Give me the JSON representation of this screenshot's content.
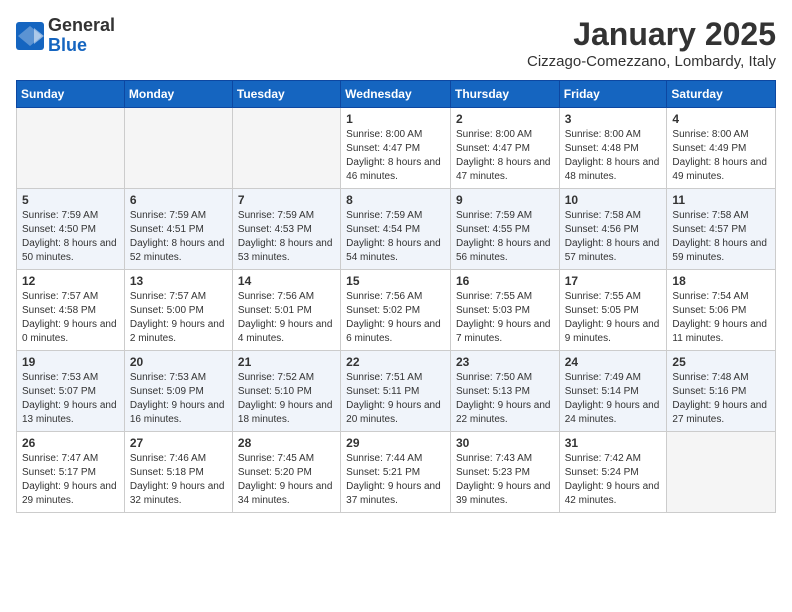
{
  "header": {
    "logo": {
      "general": "General",
      "blue": "Blue"
    },
    "title": "January 2025",
    "location": "Cizzago-Comezzano, Lombardy, Italy"
  },
  "days_of_week": [
    "Sunday",
    "Monday",
    "Tuesday",
    "Wednesday",
    "Thursday",
    "Friday",
    "Saturday"
  ],
  "weeks": [
    [
      {
        "day": "",
        "info": ""
      },
      {
        "day": "",
        "info": ""
      },
      {
        "day": "",
        "info": ""
      },
      {
        "day": "1",
        "info": "Sunrise: 8:00 AM\nSunset: 4:47 PM\nDaylight: 8 hours and 46 minutes."
      },
      {
        "day": "2",
        "info": "Sunrise: 8:00 AM\nSunset: 4:47 PM\nDaylight: 8 hours and 47 minutes."
      },
      {
        "day": "3",
        "info": "Sunrise: 8:00 AM\nSunset: 4:48 PM\nDaylight: 8 hours and 48 minutes."
      },
      {
        "day": "4",
        "info": "Sunrise: 8:00 AM\nSunset: 4:49 PM\nDaylight: 8 hours and 49 minutes."
      }
    ],
    [
      {
        "day": "5",
        "info": "Sunrise: 7:59 AM\nSunset: 4:50 PM\nDaylight: 8 hours and 50 minutes."
      },
      {
        "day": "6",
        "info": "Sunrise: 7:59 AM\nSunset: 4:51 PM\nDaylight: 8 hours and 52 minutes."
      },
      {
        "day": "7",
        "info": "Sunrise: 7:59 AM\nSunset: 4:53 PM\nDaylight: 8 hours and 53 minutes."
      },
      {
        "day": "8",
        "info": "Sunrise: 7:59 AM\nSunset: 4:54 PM\nDaylight: 8 hours and 54 minutes."
      },
      {
        "day": "9",
        "info": "Sunrise: 7:59 AM\nSunset: 4:55 PM\nDaylight: 8 hours and 56 minutes."
      },
      {
        "day": "10",
        "info": "Sunrise: 7:58 AM\nSunset: 4:56 PM\nDaylight: 8 hours and 57 minutes."
      },
      {
        "day": "11",
        "info": "Sunrise: 7:58 AM\nSunset: 4:57 PM\nDaylight: 8 hours and 59 minutes."
      }
    ],
    [
      {
        "day": "12",
        "info": "Sunrise: 7:57 AM\nSunset: 4:58 PM\nDaylight: 9 hours and 0 minutes."
      },
      {
        "day": "13",
        "info": "Sunrise: 7:57 AM\nSunset: 5:00 PM\nDaylight: 9 hours and 2 minutes."
      },
      {
        "day": "14",
        "info": "Sunrise: 7:56 AM\nSunset: 5:01 PM\nDaylight: 9 hours and 4 minutes."
      },
      {
        "day": "15",
        "info": "Sunrise: 7:56 AM\nSunset: 5:02 PM\nDaylight: 9 hours and 6 minutes."
      },
      {
        "day": "16",
        "info": "Sunrise: 7:55 AM\nSunset: 5:03 PM\nDaylight: 9 hours and 7 minutes."
      },
      {
        "day": "17",
        "info": "Sunrise: 7:55 AM\nSunset: 5:05 PM\nDaylight: 9 hours and 9 minutes."
      },
      {
        "day": "18",
        "info": "Sunrise: 7:54 AM\nSunset: 5:06 PM\nDaylight: 9 hours and 11 minutes."
      }
    ],
    [
      {
        "day": "19",
        "info": "Sunrise: 7:53 AM\nSunset: 5:07 PM\nDaylight: 9 hours and 13 minutes."
      },
      {
        "day": "20",
        "info": "Sunrise: 7:53 AM\nSunset: 5:09 PM\nDaylight: 9 hours and 16 minutes."
      },
      {
        "day": "21",
        "info": "Sunrise: 7:52 AM\nSunset: 5:10 PM\nDaylight: 9 hours and 18 minutes."
      },
      {
        "day": "22",
        "info": "Sunrise: 7:51 AM\nSunset: 5:11 PM\nDaylight: 9 hours and 20 minutes."
      },
      {
        "day": "23",
        "info": "Sunrise: 7:50 AM\nSunset: 5:13 PM\nDaylight: 9 hours and 22 minutes."
      },
      {
        "day": "24",
        "info": "Sunrise: 7:49 AM\nSunset: 5:14 PM\nDaylight: 9 hours and 24 minutes."
      },
      {
        "day": "25",
        "info": "Sunrise: 7:48 AM\nSunset: 5:16 PM\nDaylight: 9 hours and 27 minutes."
      }
    ],
    [
      {
        "day": "26",
        "info": "Sunrise: 7:47 AM\nSunset: 5:17 PM\nDaylight: 9 hours and 29 minutes."
      },
      {
        "day": "27",
        "info": "Sunrise: 7:46 AM\nSunset: 5:18 PM\nDaylight: 9 hours and 32 minutes."
      },
      {
        "day": "28",
        "info": "Sunrise: 7:45 AM\nSunset: 5:20 PM\nDaylight: 9 hours and 34 minutes."
      },
      {
        "day": "29",
        "info": "Sunrise: 7:44 AM\nSunset: 5:21 PM\nDaylight: 9 hours and 37 minutes."
      },
      {
        "day": "30",
        "info": "Sunrise: 7:43 AM\nSunset: 5:23 PM\nDaylight: 9 hours and 39 minutes."
      },
      {
        "day": "31",
        "info": "Sunrise: 7:42 AM\nSunset: 5:24 PM\nDaylight: 9 hours and 42 minutes."
      },
      {
        "day": "",
        "info": ""
      }
    ]
  ]
}
